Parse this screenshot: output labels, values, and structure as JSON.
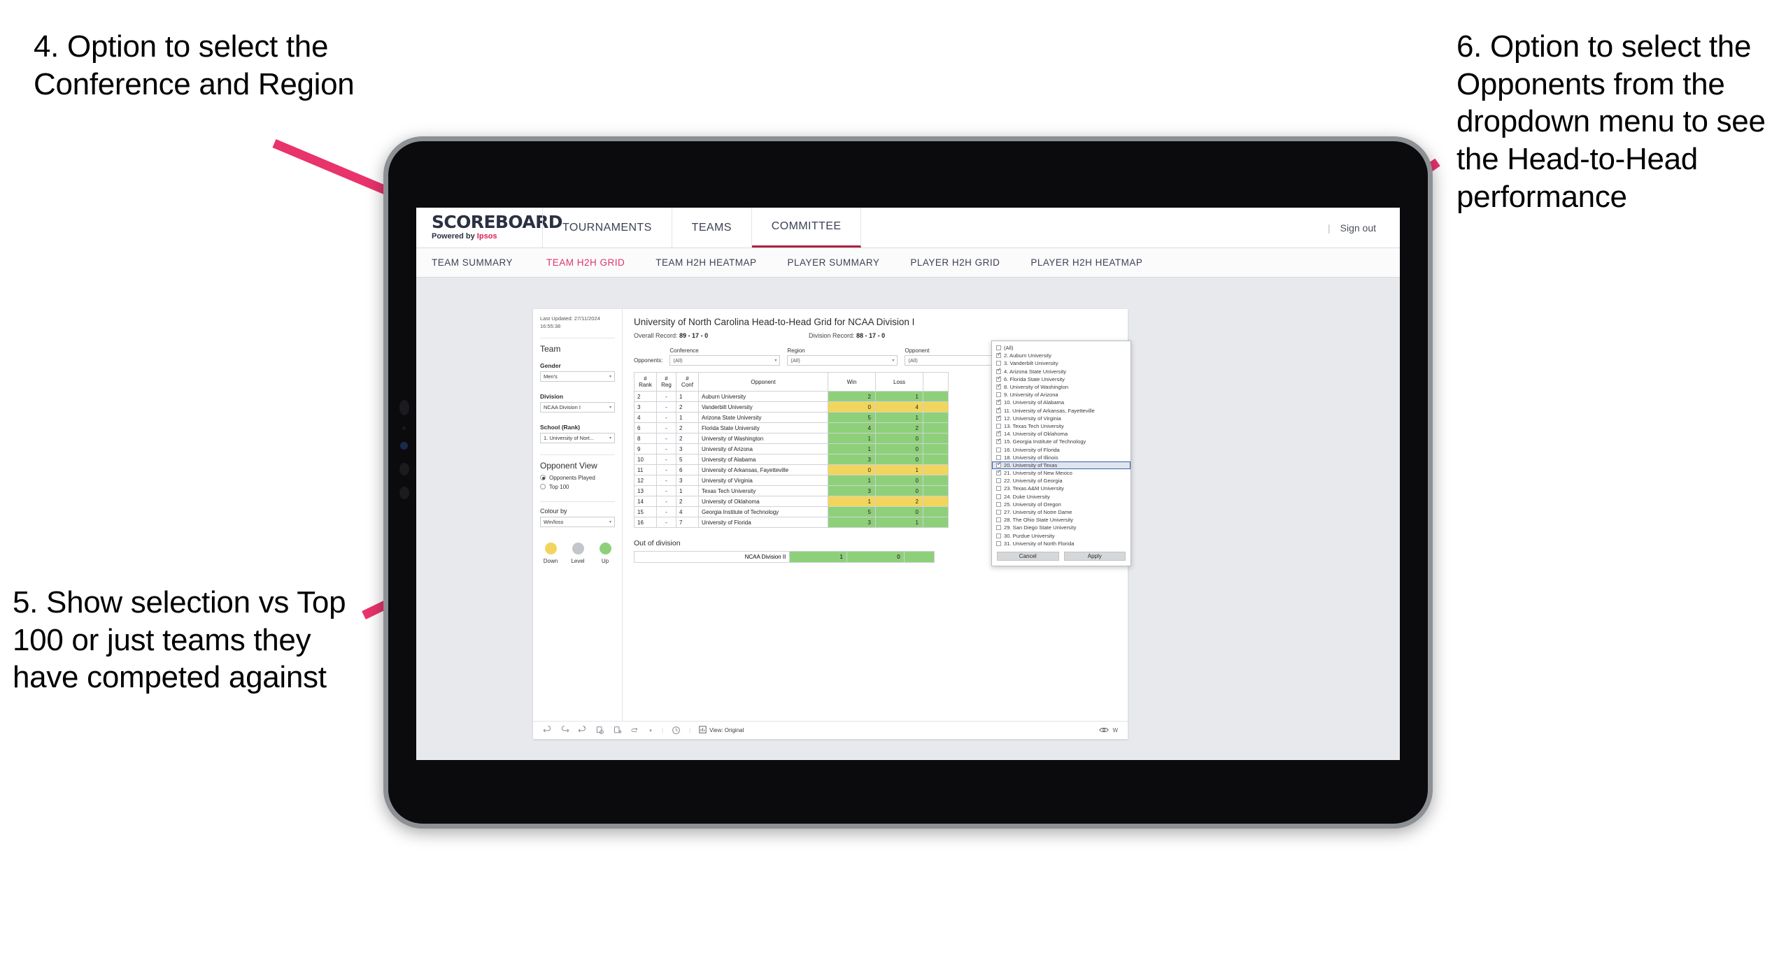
{
  "annotations": [
    {
      "id": "4",
      "text": "4. Option to select the Conference and Region"
    },
    {
      "id": "5",
      "text": "5. Show selection vs Top 100 or just teams they have competed against"
    },
    {
      "id": "6",
      "text": "6. Option to select the Opponents from the dropdown menu to see the Head-to-Head performance"
    }
  ],
  "header": {
    "brand_title": "SCOREBOARD",
    "brand_sub_prefix": "Powered by ",
    "brand_sub_accent": "Ipsos",
    "nav_tabs": [
      {
        "label": "TOURNAMENTS",
        "active": false
      },
      {
        "label": "TEAMS",
        "active": false
      },
      {
        "label": "COMMITTEE",
        "active": true
      }
    ],
    "divider": "|",
    "sign_out": "Sign out"
  },
  "subnav": {
    "tabs": [
      {
        "label": "TEAM SUMMARY",
        "active": false
      },
      {
        "label": "TEAM H2H GRID",
        "active": true
      },
      {
        "label": "TEAM H2H HEATMAP",
        "active": false
      },
      {
        "label": "PLAYER SUMMARY",
        "active": false
      },
      {
        "label": "PLAYER H2H GRID",
        "active": false
      },
      {
        "label": "PLAYER H2H HEATMAP",
        "active": false
      }
    ]
  },
  "sidebar": {
    "last_updated_line1": "Last Updated: 27/11/2024",
    "last_updated_line2": "16:55:38",
    "team_heading": "Team",
    "gender_label": "Gender",
    "gender_value": "Men's",
    "division_label": "Division",
    "division_value": "NCAA Division I",
    "school_label": "School (Rank)",
    "school_value": "1. University of Nort...",
    "opponent_view_heading": "Opponent View",
    "opponent_view_options": [
      {
        "label": "Opponents Played",
        "selected": true
      },
      {
        "label": "Top 100",
        "selected": false
      }
    ],
    "colour_by_label": "Colour by",
    "colour_by_value": "Win/loss",
    "legend": [
      {
        "label": "Down",
        "color": "#f2d55c"
      },
      {
        "label": "Level",
        "color": "#c3c6cb"
      },
      {
        "label": "Up",
        "color": "#8ed07a"
      }
    ]
  },
  "main": {
    "title": "University of North Carolina Head-to-Head Grid for NCAA Division I",
    "overall_record_label": "Overall Record:",
    "overall_record_value": "89 - 17 - 0",
    "division_record_label": "Division Record:",
    "division_record_value": "88 - 17 - 0",
    "opponents_lead": "Opponents:",
    "filters": [
      {
        "label": "Conference",
        "value": "(All)"
      },
      {
        "label": "Region",
        "value": "(All)"
      },
      {
        "label": "Opponent",
        "value": "(All)"
      }
    ],
    "table": {
      "headers": [
        "#\nRank",
        "#\nReg",
        "#\nConf",
        "Opponent",
        "Win",
        "Loss"
      ],
      "header_rank_l1": "#",
      "header_rank_l2": "Rank",
      "header_reg_l1": "#",
      "header_reg_l2": "Reg",
      "header_conf_l1": "#",
      "header_conf_l2": "Conf",
      "header_opponent": "Opponent",
      "header_win": "Win",
      "header_loss": "Loss",
      "rows": [
        {
          "rank": "2",
          "reg": "-",
          "conf": "1",
          "opponent": "Auburn University",
          "win": "2",
          "loss": "1",
          "state": "up"
        },
        {
          "rank": "3",
          "reg": "-",
          "conf": "2",
          "opponent": "Vanderbilt University",
          "win": "0",
          "loss": "4",
          "state": "down"
        },
        {
          "rank": "4",
          "reg": "-",
          "conf": "1",
          "opponent": "Arizona State University",
          "win": "5",
          "loss": "1",
          "state": "up"
        },
        {
          "rank": "6",
          "reg": "-",
          "conf": "2",
          "opponent": "Florida State University",
          "win": "4",
          "loss": "2",
          "state": "up"
        },
        {
          "rank": "8",
          "reg": "-",
          "conf": "2",
          "opponent": "University of Washington",
          "win": "1",
          "loss": "0",
          "state": "up"
        },
        {
          "rank": "9",
          "reg": "-",
          "conf": "3",
          "opponent": "University of Arizona",
          "win": "1",
          "loss": "0",
          "state": "up"
        },
        {
          "rank": "10",
          "reg": "-",
          "conf": "5",
          "opponent": "University of Alabama",
          "win": "3",
          "loss": "0",
          "state": "up"
        },
        {
          "rank": "11",
          "reg": "-",
          "conf": "6",
          "opponent": "University of Arkansas, Fayetteville",
          "win": "0",
          "loss": "1",
          "state": "down"
        },
        {
          "rank": "12",
          "reg": "-",
          "conf": "3",
          "opponent": "University of Virginia",
          "win": "1",
          "loss": "0",
          "state": "up"
        },
        {
          "rank": "13",
          "reg": "-",
          "conf": "1",
          "opponent": "Texas Tech University",
          "win": "3",
          "loss": "0",
          "state": "up"
        },
        {
          "rank": "14",
          "reg": "-",
          "conf": "2",
          "opponent": "University of Oklahoma",
          "win": "1",
          "loss": "2",
          "state": "down"
        },
        {
          "rank": "15",
          "reg": "-",
          "conf": "4",
          "opponent": "Georgia Institute of Technology",
          "win": "5",
          "loss": "0",
          "state": "up"
        },
        {
          "rank": "16",
          "reg": "-",
          "conf": "7",
          "opponent": "University of Florida",
          "win": "3",
          "loss": "1",
          "state": "up"
        }
      ]
    },
    "out_of_division": {
      "title": "Out of division",
      "rows": [
        {
          "label": "NCAA Division II",
          "win": "1",
          "loss": "0",
          "state": "up"
        }
      ]
    }
  },
  "opponent_dropdown": {
    "items": [
      {
        "label": "(All)",
        "checked": false,
        "selected": false
      },
      {
        "label": "2. Auburn University",
        "checked": true,
        "selected": false
      },
      {
        "label": "3. Vanderbilt University",
        "checked": false,
        "selected": false
      },
      {
        "label": "4. Arizona State University",
        "checked": true,
        "selected": false
      },
      {
        "label": "6. Florida State University",
        "checked": true,
        "selected": false
      },
      {
        "label": "8. University of Washington",
        "checked": true,
        "selected": false
      },
      {
        "label": "9. University of Arizona",
        "checked": false,
        "selected": false
      },
      {
        "label": "10. University of Alabama",
        "checked": true,
        "selected": false
      },
      {
        "label": "11. University of Arkansas, Fayetteville",
        "checked": true,
        "selected": false
      },
      {
        "label": "12. University of Virginia",
        "checked": true,
        "selected": false
      },
      {
        "label": "13. Texas Tech University",
        "checked": false,
        "selected": false
      },
      {
        "label": "14. University of Oklahoma",
        "checked": true,
        "selected": false
      },
      {
        "label": "15. Georgia Institute of Technology",
        "checked": true,
        "selected": false
      },
      {
        "label": "16. University of Florida",
        "checked": false,
        "selected": false
      },
      {
        "label": "18. University of Illinois",
        "checked": false,
        "selected": false
      },
      {
        "label": "20. University of Texas",
        "checked": true,
        "selected": true
      },
      {
        "label": "21. University of New Mexico",
        "checked": true,
        "selected": false
      },
      {
        "label": "22. University of Georgia",
        "checked": false,
        "selected": false
      },
      {
        "label": "23. Texas A&M University",
        "checked": false,
        "selected": false
      },
      {
        "label": "24. Duke University",
        "checked": false,
        "selected": false
      },
      {
        "label": "25. University of Oregon",
        "checked": false,
        "selected": false
      },
      {
        "label": "27. University of Notre Dame",
        "checked": false,
        "selected": false
      },
      {
        "label": "28. The Ohio State University",
        "checked": false,
        "selected": false
      },
      {
        "label": "29. San Diego State University",
        "checked": false,
        "selected": false
      },
      {
        "label": "30. Purdue University",
        "checked": false,
        "selected": false
      },
      {
        "label": "31. University of North Florida",
        "checked": false,
        "selected": false
      }
    ],
    "cancel_label": "Cancel",
    "apply_label": "Apply"
  },
  "toolbar": {
    "view_label": "View: Original",
    "right_label": "W",
    "separator": "|"
  },
  "colors": {
    "accent_pink": "#e8336b",
    "brand_red": "#b02040",
    "up_green": "#8ed07a",
    "down_yellow": "#f2d55c",
    "level_grey": "#c3c6cb"
  }
}
